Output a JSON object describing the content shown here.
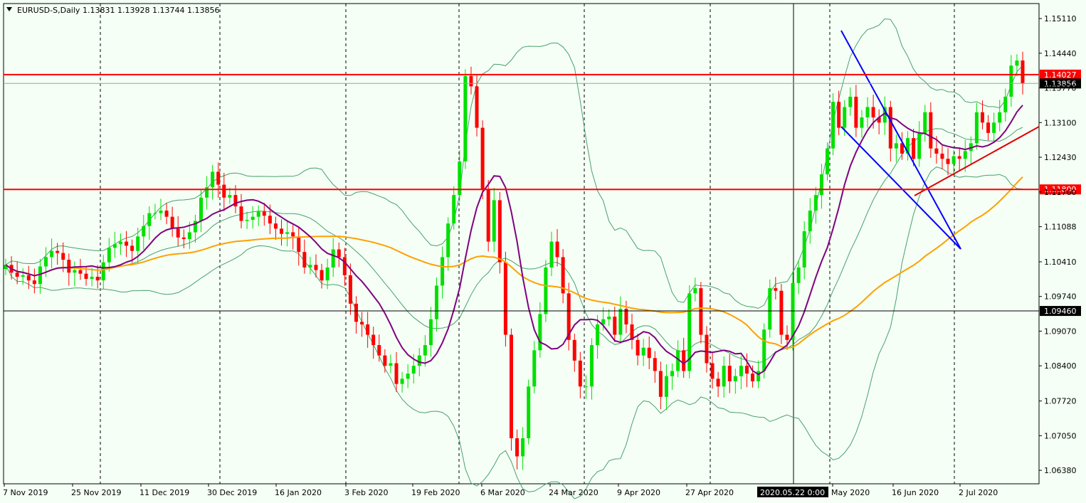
{
  "header": {
    "symbol_label": "EURUSD-S,Daily",
    "ohlc": "1.13831 1.13928 1.13744 1.13856"
  },
  "chart_data": {
    "type": "candlestick",
    "symbol": "EURUSD-S",
    "timeframe": "Daily",
    "ylim": [
      1.0612,
      1.154
    ],
    "y_ticks": [
      "1.15110",
      "1.14440",
      "1.13770",
      "1.13100",
      "1.12430",
      "1.11760",
      "1.11088",
      "1.10410",
      "1.09740",
      "1.09070",
      "1.08400",
      "1.07720",
      "1.07050",
      "1.06380"
    ],
    "x_ticks": [
      "7 Nov 2019",
      "25 Nov 2019",
      "11 Dec 2019",
      "30 Dec 2019",
      "16 Jan 2020",
      "3 Feb 2020",
      "19 Feb 2020",
      "6 Mar 2020",
      "24 Mar 2020",
      "9 Apr 2020",
      "27 Apr 2020",
      "2020.05.22 0:00",
      "May 2020",
      "16 Jun 2020",
      "2 Jul 2020"
    ],
    "crosshair_label": "2020.05.22 0:00",
    "horizontal_levels": [
      {
        "label": "1.14027",
        "value": 1.14027,
        "color": "#ff0000"
      },
      {
        "label": "1.11809",
        "value": 1.11809,
        "color": "#ff0000"
      },
      {
        "label": "1.09460",
        "value": 1.0946,
        "color": "#000000"
      },
      {
        "label": "1.13856",
        "value": 1.13856,
        "color": "#c0c0c0",
        "note": "current price"
      }
    ],
    "closes": [
      1.1035,
      1.102,
      1.1012,
      1.1015,
      1.1005,
      1.0998,
      1.1032,
      1.105,
      1.1062,
      1.1058,
      1.1045,
      1.102,
      1.1025,
      1.1018,
      1.1008,
      1.1012,
      1.1005,
      1.104,
      1.1068,
      1.1075,
      1.108,
      1.1072,
      1.1062,
      1.109,
      1.111,
      1.1135,
      1.1135,
      1.114,
      1.1128,
      1.1105,
      1.1088,
      1.1085,
      1.1098,
      1.112,
      1.1165,
      1.1185,
      1.1215,
      1.119,
      1.1165,
      1.117,
      1.1148,
      1.112,
      1.1122,
      1.1128,
      1.1138,
      1.113,
      1.1115,
      1.1105,
      1.1095,
      1.1098,
      1.109,
      1.106,
      1.103,
      1.1035,
      1.1025,
      1.1005,
      1.103,
      1.1065,
      1.105,
      1.1015,
      1.096,
      1.0925,
      1.092,
      1.09,
      1.088,
      1.086,
      1.084,
      1.0845,
      1.0805,
      1.0815,
      1.0825,
      1.084,
      1.086,
      1.088,
      1.093,
      1.0995,
      1.105,
      1.1115,
      1.117,
      1.1235,
      1.14,
      1.138,
      1.13,
      1.118,
      1.108,
      1.116,
      1.104,
      1.09,
      1.07,
      1.0665,
      1.07,
      1.08,
      1.087,
      1.094,
      1.103,
      1.108,
      1.105,
      1.098,
      1.089,
      1.085,
      1.08,
      1.08,
      1.088,
      1.092,
      1.093,
      1.0935,
      1.09,
      1.095,
      1.092,
      1.089,
      1.086,
      1.0875,
      1.0855,
      1.083,
      1.078,
      1.082,
      1.083,
      1.087,
      1.083,
      1.098,
      1.099,
      1.09,
      1.0845,
      1.0815,
      1.08,
      1.084,
      1.081,
      1.082,
      1.084,
      1.0825,
      1.081,
      1.083,
      1.091,
      1.099,
      1.0985,
      1.09,
      1.089,
      1.1,
      1.103,
      1.11,
      1.114,
      1.117,
      1.121,
      1.126,
      1.135,
      1.13,
      1.134,
      1.136,
      1.13,
      1.132,
      1.134,
      1.132,
      1.131,
      1.134,
      1.126,
      1.127,
      1.125,
      1.128,
      1.124,
      1.129,
      1.133,
      1.126,
      1.125,
      1.124,
      1.123,
      1.1245,
      1.124,
      1.1255,
      1.127,
      1.133,
      1.131,
      1.129,
      1.131,
      1.133,
      1.136,
      1.142,
      1.143,
      1.1386
    ]
  }
}
